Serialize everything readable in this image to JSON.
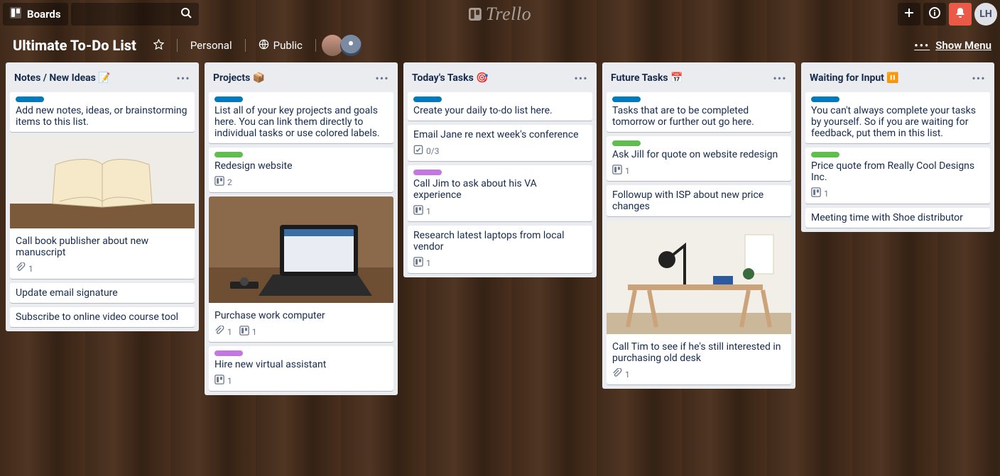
{
  "app_name": "Trello",
  "topbar": {
    "boards_label": "Boards",
    "user_initials": "LH"
  },
  "board": {
    "title": "Ultimate To-Do List",
    "team": "Personal",
    "visibility": "Public",
    "show_menu_label": "Show Menu",
    "members": [
      "M1",
      "M2"
    ]
  },
  "lists": [
    {
      "title": "Notes / New Ideas 📝",
      "cards": [
        {
          "labels": [
            "blue"
          ],
          "text": "Add new notes, ideas, or brainstorming items to this list."
        },
        {
          "cover": "book",
          "text": "Call book publisher about new manuscript",
          "badges": {
            "attachments": 1
          }
        },
        {
          "text": "Update email signature"
        },
        {
          "text": "Subscribe to online video course tool"
        }
      ]
    },
    {
      "title": "Projects 📦",
      "cards": [
        {
          "labels": [
            "blue"
          ],
          "text": "List all of your key projects and goals here. You can link them directly to individual tasks or use colored labels."
        },
        {
          "labels": [
            "green"
          ],
          "text": "Redesign website",
          "badges": {
            "trello": 2
          }
        },
        {
          "cover": "laptop",
          "text": "Purchase work computer",
          "badges": {
            "attachments": 1,
            "trello": 1
          }
        },
        {
          "labels": [
            "purple"
          ],
          "text": "Hire new virtual assistant",
          "badges": {
            "trello": 1
          }
        }
      ]
    },
    {
      "title": "Today's Tasks 🎯",
      "cards": [
        {
          "labels": [
            "blue"
          ],
          "text": "Create your daily to-do list here."
        },
        {
          "text": "Email Jane re next week's conference",
          "badges": {
            "checklist": "0/3"
          }
        },
        {
          "labels": [
            "purple"
          ],
          "text": "Call Jim to ask about his VA experience",
          "badges": {
            "trello": 1
          }
        },
        {
          "text": "Research latest laptops from local vendor",
          "badges": {
            "trello": 1
          }
        }
      ]
    },
    {
      "title": "Future Tasks 📅",
      "cards": [
        {
          "labels": [
            "blue"
          ],
          "text": "Tasks that are to be completed tomorrow or further out go here."
        },
        {
          "labels": [
            "green"
          ],
          "text": "Ask Jill for quote on website redesign",
          "badges": {
            "trello": 1
          }
        },
        {
          "text": "Followup with ISP about new price changes"
        },
        {
          "cover": "desk",
          "text": "Call Tim to see if he's still interested in purchasing old desk",
          "badges": {
            "attachments": 1
          }
        }
      ]
    },
    {
      "title": "Waiting for Input ⏸️",
      "cards": [
        {
          "labels": [
            "blue"
          ],
          "text": "You can't always complete your tasks by yourself. So if you are waiting for feedback, put them in this list."
        },
        {
          "labels": [
            "green"
          ],
          "text": "Price quote from Really Cool Designs Inc.",
          "badges": {
            "trello": 1
          }
        },
        {
          "text": "Meeting time with Shoe distributor"
        }
      ]
    }
  ]
}
